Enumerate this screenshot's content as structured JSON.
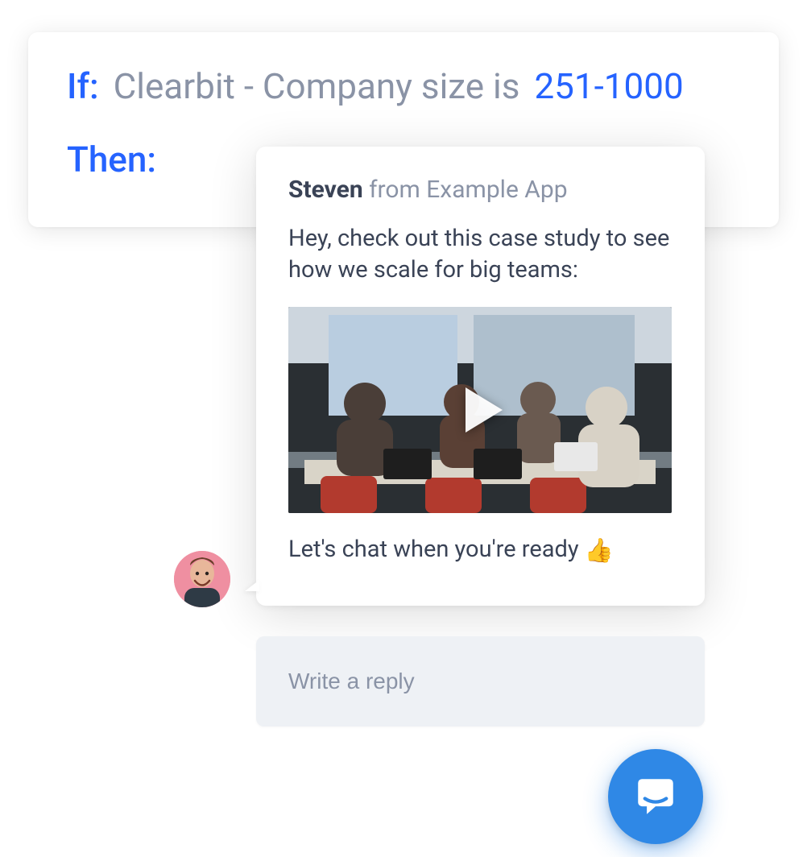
{
  "rule": {
    "if_keyword": "If:",
    "attribute": "Clearbit - Company size is",
    "value": "251-1000",
    "then_keyword": "Then:"
  },
  "chat": {
    "sender_name": "Steven",
    "sender_from": " from Example App",
    "line1": "Hey, check out this case study to see how we scale for big teams:",
    "line2": "Let's chat when you're ready ",
    "emoji": "👍"
  },
  "reply": {
    "placeholder": "Write a reply"
  },
  "icons": {
    "avatar": "avatar-steven",
    "play": "play-icon",
    "launcher": "intercom-launcher-icon"
  }
}
